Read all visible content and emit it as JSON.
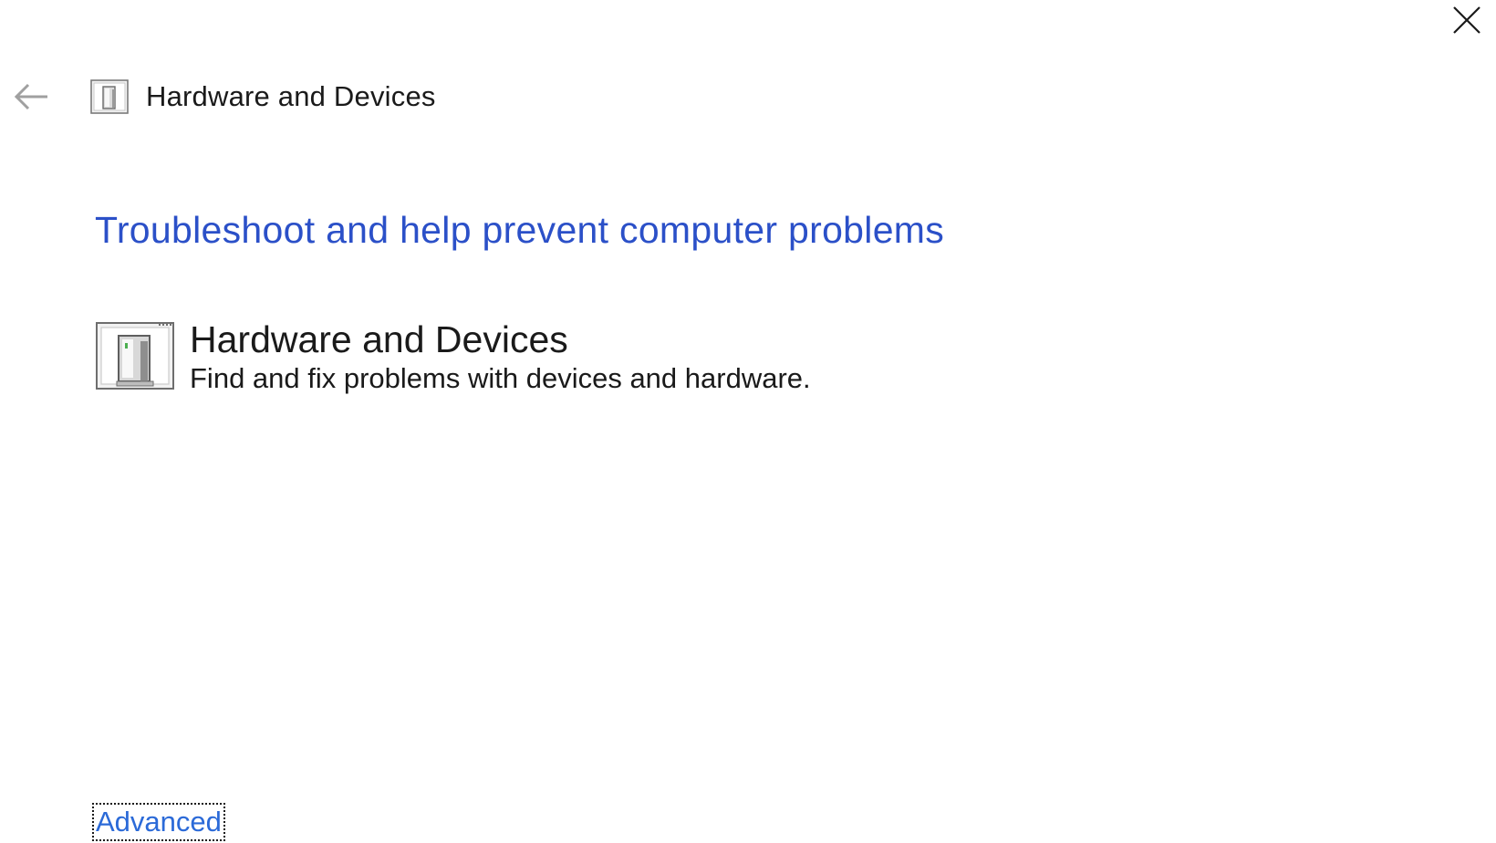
{
  "window": {
    "close_icon": "close-icon"
  },
  "header": {
    "back_icon": "back-arrow-icon",
    "icon": "hardware-devices-icon",
    "title": "Hardware and Devices"
  },
  "main": {
    "heading": "Troubleshoot and help prevent computer problems",
    "troubleshooter": {
      "icon": "hardware-devices-icon",
      "title": "Hardware and Devices",
      "description": "Find and fix problems with devices and hardware."
    }
  },
  "footer": {
    "advanced_link": "Advanced"
  },
  "colors": {
    "heading_blue": "#2b50c8",
    "link_blue": "#2b6ad8",
    "text": "#1a1a1a",
    "background": "#ffffff"
  }
}
